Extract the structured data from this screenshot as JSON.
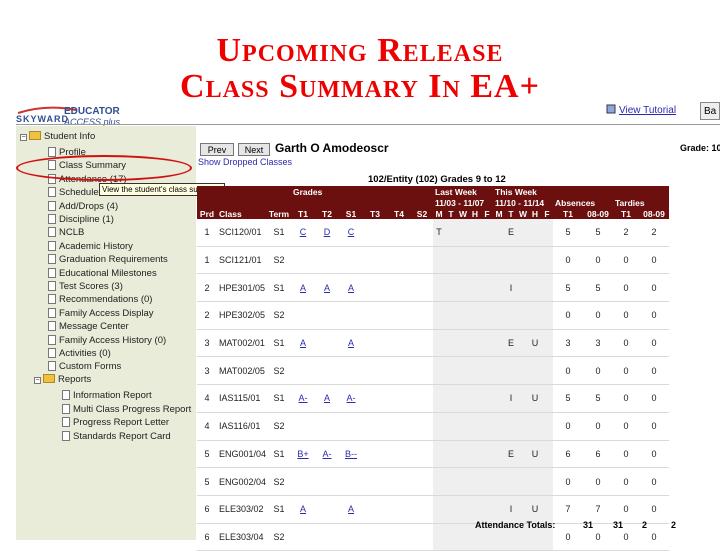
{
  "title": {
    "line1": "Upcoming Release",
    "line2": "Class Summary In EA+"
  },
  "logo": {
    "brand": "SKYWARD",
    "product": "EDUCATOR",
    "sub": "ACCESS plus"
  },
  "header": {
    "view_tutorial": "View Tutorial",
    "ba_label": "Ba"
  },
  "sidebar": {
    "root_label": "Student Info",
    "items": [
      {
        "label": "Profile"
      },
      {
        "label": "Class Summary"
      },
      {
        "label": "Attendance (17)"
      },
      {
        "label": "Schedule"
      },
      {
        "label": "Add/Drops (4)"
      },
      {
        "label": "Discipline (1)"
      },
      {
        "label": "NCLB"
      },
      {
        "label": "Academic History"
      },
      {
        "label": "Graduation Requirements"
      },
      {
        "label": "Educational Milestones"
      },
      {
        "label": "Test Scores (3)"
      },
      {
        "label": "Recommendations (0)"
      },
      {
        "label": "Family Access Display"
      },
      {
        "label": "Message Center"
      },
      {
        "label": "Family Access History (0)"
      },
      {
        "label": "Activities (0)"
      },
      {
        "label": "Custom Forms"
      }
    ],
    "reports_label": "Reports",
    "reports": [
      {
        "label": "Information Report"
      },
      {
        "label": "Multi Class Progress Report"
      },
      {
        "label": "Progress Report Letter"
      },
      {
        "label": "Standards Report Card"
      }
    ],
    "tooltip": "View the student's class summary"
  },
  "nav": {
    "prev": "Prev",
    "next": "Next",
    "student_name": "Garth O Amodeoscr",
    "grade": "Grade: 10",
    "show_dropped": "Show Dropped Classes"
  },
  "entity": "102/Entity (102) Grades 9 to 12",
  "table": {
    "group_headers": {
      "grades": "Grades",
      "last_week": "Last Week",
      "last_week_range": "11/03 - 11/07",
      "this_week": "This Week",
      "this_week_range": "11/10 - 11/14",
      "absences": "Absences",
      "tardies": "Tardies"
    },
    "columns": [
      "Prd",
      "Class",
      "Term",
      "T1",
      "T2",
      "S1",
      "T3",
      "T4",
      "S2",
      "M",
      "T",
      "W",
      "H",
      "F",
      "M",
      "T",
      "W",
      "H",
      "F",
      "T1",
      "08-09",
      "T1",
      "08-09"
    ],
    "rows": [
      {
        "prd": "1",
        "class": "SCI120/01",
        "term": "S1",
        "t1": "C",
        "t2": "D",
        "s1": "C",
        "lw": "T",
        "tw": "E",
        "twu": "",
        "abs_t1": "5",
        "abs_yr": "5",
        "tar_t1": "2",
        "tar_yr": "2"
      },
      {
        "prd": "1",
        "class": "SCI121/01",
        "term": "S2",
        "t1": "",
        "t2": "",
        "s1": "",
        "lw": "",
        "tw": "",
        "twu": "",
        "abs_t1": "0",
        "abs_yr": "0",
        "tar_t1": "0",
        "tar_yr": "0"
      },
      {
        "prd": "2",
        "class": "HPE301/05",
        "term": "S1",
        "t1": "A",
        "t2": "A",
        "s1": "A",
        "lw": "",
        "tw": "I",
        "twu": "",
        "abs_t1": "5",
        "abs_yr": "5",
        "tar_t1": "0",
        "tar_yr": "0"
      },
      {
        "prd": "2",
        "class": "HPE302/05",
        "term": "S2",
        "t1": "",
        "t2": "",
        "s1": "",
        "lw": "",
        "tw": "",
        "twu": "",
        "abs_t1": "0",
        "abs_yr": "0",
        "tar_t1": "0",
        "tar_yr": "0"
      },
      {
        "prd": "3",
        "class": "MAT002/01",
        "term": "S1",
        "t1": "A",
        "t2": "",
        "s1": "A",
        "lw": "",
        "tw": "E",
        "twu": "U",
        "abs_t1": "3",
        "abs_yr": "3",
        "tar_t1": "0",
        "tar_yr": "0"
      },
      {
        "prd": "3",
        "class": "MAT002/05",
        "term": "S2",
        "t1": "",
        "t2": "",
        "s1": "",
        "lw": "",
        "tw": "",
        "twu": "",
        "abs_t1": "0",
        "abs_yr": "0",
        "tar_t1": "0",
        "tar_yr": "0"
      },
      {
        "prd": "4",
        "class": "IAS115/01",
        "term": "S1",
        "t1": "A-",
        "t2": "A",
        "s1": "A-",
        "lw": "",
        "tw": "I",
        "twu": "U",
        "abs_t1": "5",
        "abs_yr": "5",
        "tar_t1": "0",
        "tar_yr": "0"
      },
      {
        "prd": "4",
        "class": "IAS116/01",
        "term": "S2",
        "t1": "",
        "t2": "",
        "s1": "",
        "lw": "",
        "tw": "",
        "twu": "",
        "abs_t1": "0",
        "abs_yr": "0",
        "tar_t1": "0",
        "tar_yr": "0"
      },
      {
        "prd": "5",
        "class": "ENG001/04",
        "term": "S1",
        "t1": "B+",
        "t2": "A-",
        "s1": "B--",
        "lw": "",
        "tw": "E",
        "twu": "U",
        "abs_t1": "6",
        "abs_yr": "6",
        "tar_t1": "0",
        "tar_yr": "0"
      },
      {
        "prd": "5",
        "class": "ENG002/04",
        "term": "S2",
        "t1": "",
        "t2": "",
        "s1": "",
        "lw": "",
        "tw": "",
        "twu": "",
        "abs_t1": "0",
        "abs_yr": "0",
        "tar_t1": "0",
        "tar_yr": "0"
      },
      {
        "prd": "6",
        "class": "ELE303/02",
        "term": "S1",
        "t1": "A",
        "t2": "",
        "s1": "A",
        "lw": "",
        "tw": "I",
        "twu": "U",
        "abs_t1": "7",
        "abs_yr": "7",
        "tar_t1": "0",
        "tar_yr": "0"
      },
      {
        "prd": "6",
        "class": "ELE303/04",
        "term": "S2",
        "t1": "",
        "t2": "",
        "s1": "",
        "lw": "",
        "tw": "",
        "twu": "",
        "abs_t1": "0",
        "abs_yr": "0",
        "tar_t1": "0",
        "tar_yr": "0"
      }
    ],
    "totals": {
      "label": "Attendance Totals:",
      "abs_t1": "31",
      "abs_yr": "31",
      "tar_t1": "2",
      "tar_yr": "2"
    }
  },
  "colors": {
    "title": "#ee0000",
    "header_bg": "#6b0f0f",
    "sidebar_bg": "#e8ecd8",
    "link": "#2a2ab0",
    "highlight": "#d01010"
  }
}
